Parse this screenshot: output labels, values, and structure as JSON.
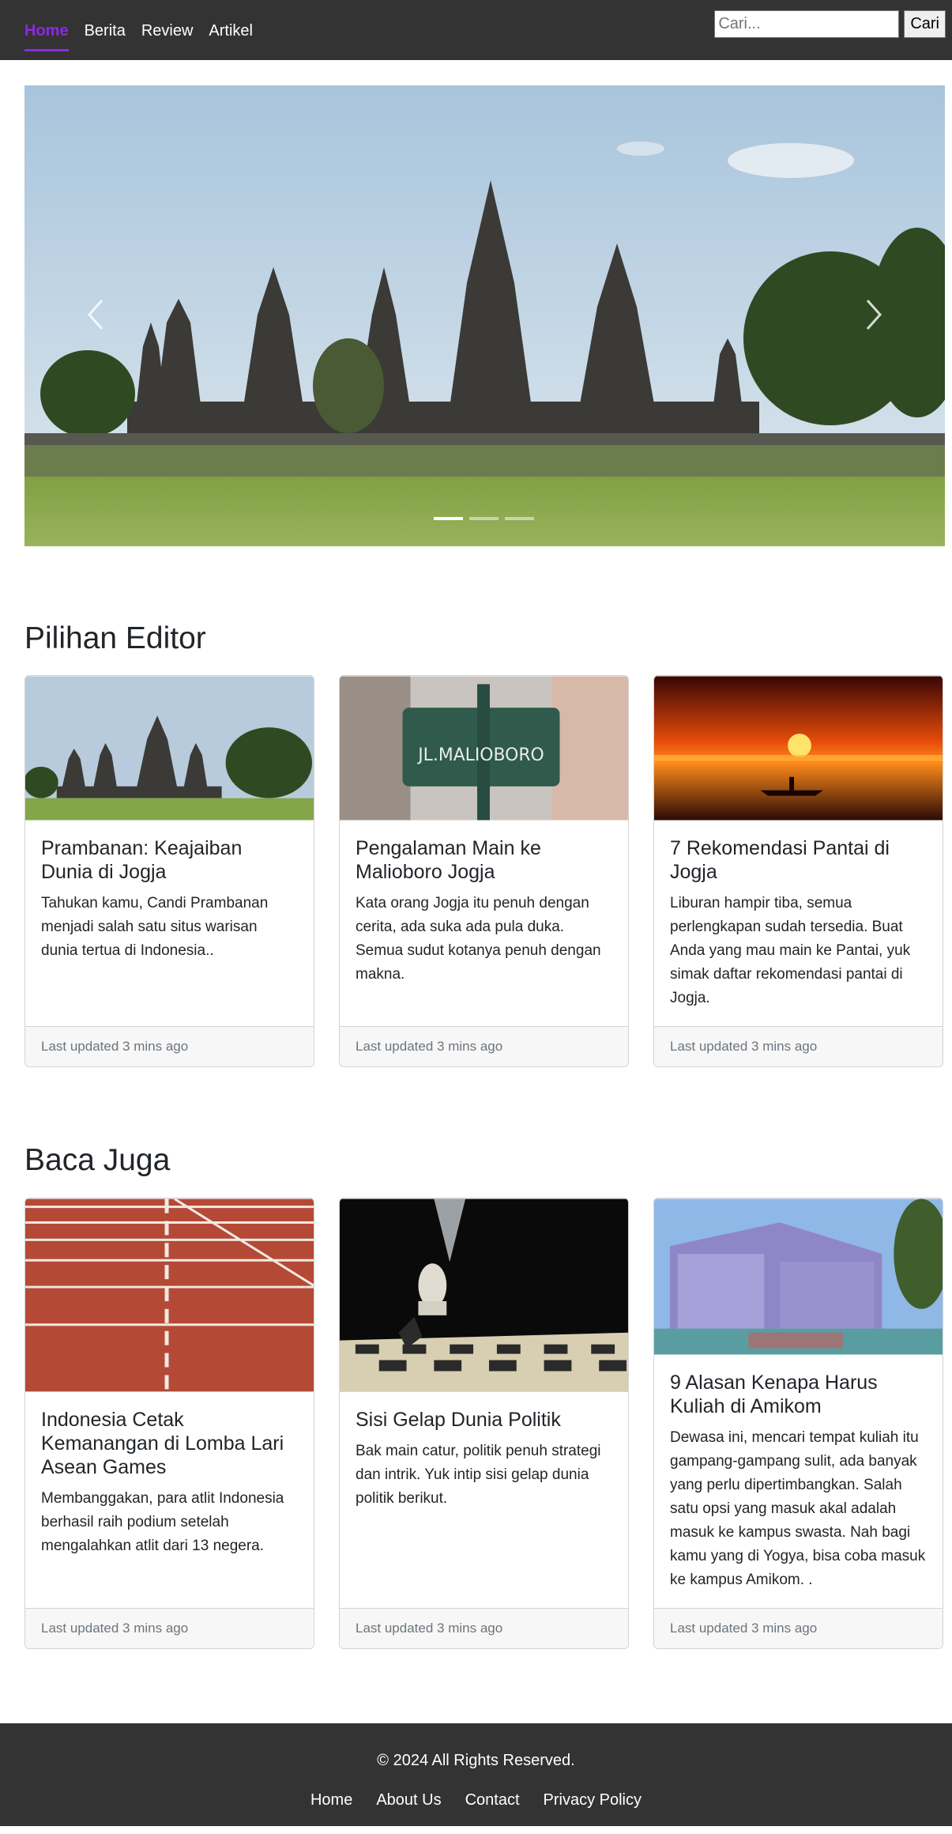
{
  "nav": {
    "links": [
      "Home",
      "Berita",
      "Review",
      "Artikel"
    ],
    "active": "Home",
    "accent_color": "#8a2be2",
    "background": "#333333"
  },
  "search": {
    "placeholder": "Cari...",
    "button_label": "Cari"
  },
  "carousel": {
    "slide_count": 3,
    "active_index": 0,
    "prev_icon": "chevron-left-icon",
    "next_icon": "chevron-right-icon"
  },
  "editor_section": {
    "title": "Pilihan Editor",
    "cards": [
      {
        "title": "Prambanan: Keajaiban Dunia di Jogja",
        "text": "Tahukan kamu, Candi Prambanan menjadi salah satu situs warisan dunia tertua di Indonesia..",
        "footer": "Last updated 3 mins ago"
      },
      {
        "title": "Pengalaman Main ke Malioboro Jogja",
        "text": "Kata orang Jogja itu penuh dengan cerita, ada suka ada pula duka. Semua sudut kotanya penuh dengan makna.",
        "footer": "Last updated 3 mins ago",
        "sign_text": "JL.MALIOBORO"
      },
      {
        "title": "7 Rekomendasi Pantai di Jogja",
        "text": "Liburan hampir tiba, semua perlengkapan sudah tersedia. Buat Anda yang mau main ke Pantai, yuk simak daftar rekomendasi pantai di Jogja.",
        "footer": "Last updated 3 mins ago"
      }
    ]
  },
  "read_section": {
    "title": "Baca Juga",
    "cards": [
      {
        "title": "Indonesia Cetak Kemanangan di Lomba Lari Asean Games",
        "text": "Membanggakan, para atlit Indonesia berhasil raih podium setelah mengalahkan atlit dari 13 negera.",
        "footer": "Last updated 3 mins ago"
      },
      {
        "title": "Sisi Gelap Dunia Politik",
        "text": "Bak main catur, politik penuh strategi dan intrik. Yuk intip sisi gelap dunia politik berikut.",
        "footer": "Last updated 3 mins ago"
      },
      {
        "title": "9 Alasan Kenapa Harus Kuliah di Amikom",
        "text": "Dewasa ini, mencari tempat kuliah itu gampang-gampang sulit, ada banyak yang perlu dipertimbangkan. Salah satu opsi yang masuk akal adalah masuk ke kampus swasta. Nah bagi kamu yang di Yogya, bisa coba masuk ke kampus Amikom. .",
        "footer": "Last updated 3 mins ago"
      }
    ]
  },
  "footer": {
    "copyright": "© 2024 All Rights Reserved.",
    "links": [
      "Home",
      "About Us",
      "Contact",
      "Privacy Policy"
    ]
  }
}
